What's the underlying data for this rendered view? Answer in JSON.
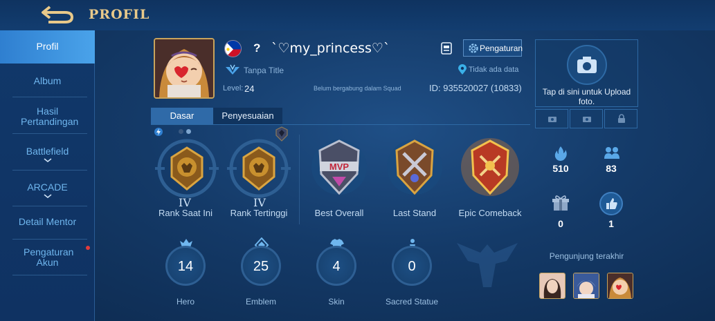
{
  "header": {
    "title": "PROFIL",
    "back_icon": "back-arrow-icon"
  },
  "sidebar": {
    "items": [
      {
        "label": "Profil"
      },
      {
        "label": "Album"
      },
      {
        "label": "Hasil Pertandingan"
      },
      {
        "label": "Battlefield"
      },
      {
        "label": "ARCADE"
      },
      {
        "label": "Detail Mentor"
      },
      {
        "label": "Pengaturan Akun"
      }
    ]
  },
  "profile": {
    "question_mark": "?",
    "username": "`♡my_princess♡`",
    "title": "Tanpa Title",
    "level_label": "Level:",
    "level_value": "24",
    "squad": "Belum bergabung dalam Squad",
    "location": "Tidak ada data",
    "id_text": "ID: 935520027 (10833)",
    "settings_label": "Pengaturan"
  },
  "tabs": [
    {
      "label": "Dasar"
    },
    {
      "label": "Penyesuaian"
    }
  ],
  "medals": [
    {
      "label": "Rank Saat Ini",
      "tier": "IV"
    },
    {
      "label": "Rank Tertinggi",
      "tier": "IV"
    },
    {
      "label": "Best Overall"
    },
    {
      "label": "Last Stand"
    },
    {
      "label": "Epic Comeback"
    }
  ],
  "stats": [
    {
      "label": "Hero",
      "value": "14"
    },
    {
      "label": "Emblem",
      "value": "25"
    },
    {
      "label": "Skin",
      "value": "4"
    },
    {
      "label": "Sacred Statue",
      "value": "0"
    }
  ],
  "right_panel": {
    "upload_text": "Tap di sini untuk Upload foto.",
    "popularity": "510",
    "followers": "83",
    "gifts": "0",
    "likes": "1",
    "visitors_title": "Pengunjung terakhir"
  },
  "colors": {
    "accent_gold": "#e8c98a",
    "active_blue": "#3a8ee0",
    "notification_red": "#e23b3b"
  }
}
